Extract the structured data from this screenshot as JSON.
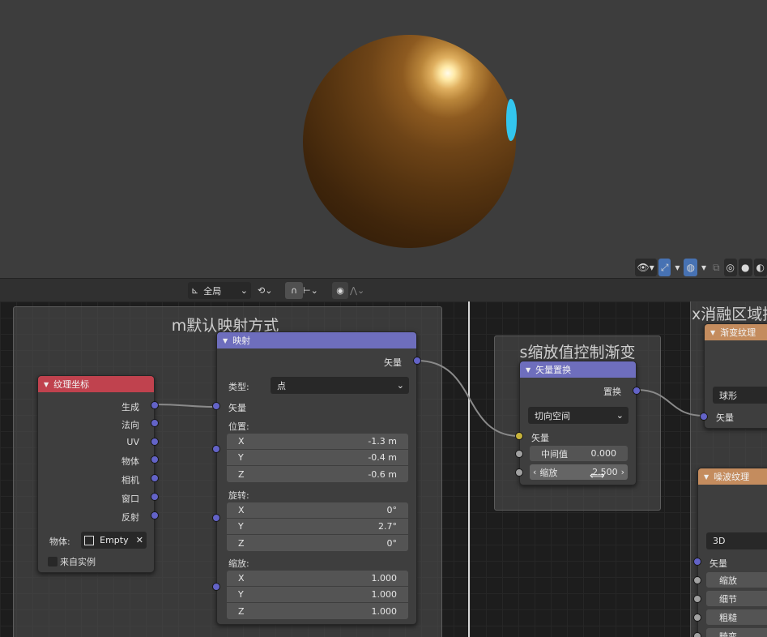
{
  "viewport": {
    "shading_icons": [
      "eye-icon",
      "gizmo-icon",
      "overlay-icon",
      "xray-icon",
      "wireframe-icon",
      "solid-icon",
      "material-icon"
    ]
  },
  "header": {
    "transform_orientation": "全局",
    "colors": {
      "bg": "#303030"
    }
  },
  "frames": {
    "mapping_frame": "m默认映射方式",
    "scale_frame": "s缩放值控制渐变",
    "blend_frame": "x消融区域控"
  },
  "tex_coord": {
    "title": "纹理坐标",
    "outputs": [
      "生成",
      "法向",
      "UV",
      "物体",
      "相机",
      "窗口",
      "反射"
    ],
    "object_label": "物体:",
    "object_value": "Empty",
    "from_instancer": "来自实例",
    "color": "#c0424e"
  },
  "mapping": {
    "title": "映射",
    "output": "矢量",
    "type_label": "类型:",
    "type_value": "点",
    "vector_input": "矢量",
    "location_label": "位置:",
    "location": [
      {
        "axis": "X",
        "value": "-1.3 m"
      },
      {
        "axis": "Y",
        "value": "-0.4 m"
      },
      {
        "axis": "Z",
        "value": "-0.6 m"
      }
    ],
    "rotation_label": "旋转:",
    "rotation": [
      {
        "axis": "X",
        "value": "0°"
      },
      {
        "axis": "Y",
        "value": "2.7°"
      },
      {
        "axis": "Z",
        "value": "0°"
      }
    ],
    "scale_label": "缩放:",
    "scale": [
      {
        "axis": "X",
        "value": "1.000"
      },
      {
        "axis": "Y",
        "value": "1.000"
      },
      {
        "axis": "Z",
        "value": "1.000"
      }
    ],
    "color": "#6e6ebd"
  },
  "disp": {
    "title": "矢量置换",
    "output": "置换",
    "space": "切向空间",
    "vector_input": "矢量",
    "midlevel_label": "中间值",
    "midlevel_value": "0.000",
    "scale_label": "缩放",
    "scale_value": "2.500",
    "color": "#6e6ebd"
  },
  "gradient": {
    "title": "渐变纹理",
    "type_value": "球形",
    "vector_input": "矢量",
    "color": "#c48c5e"
  },
  "noise": {
    "title": "噪波纹理",
    "dims": "3D",
    "inputs": [
      "矢量",
      "缩放",
      "细节",
      "粗糙",
      "畸变"
    ],
    "color": "#c48c5e"
  }
}
